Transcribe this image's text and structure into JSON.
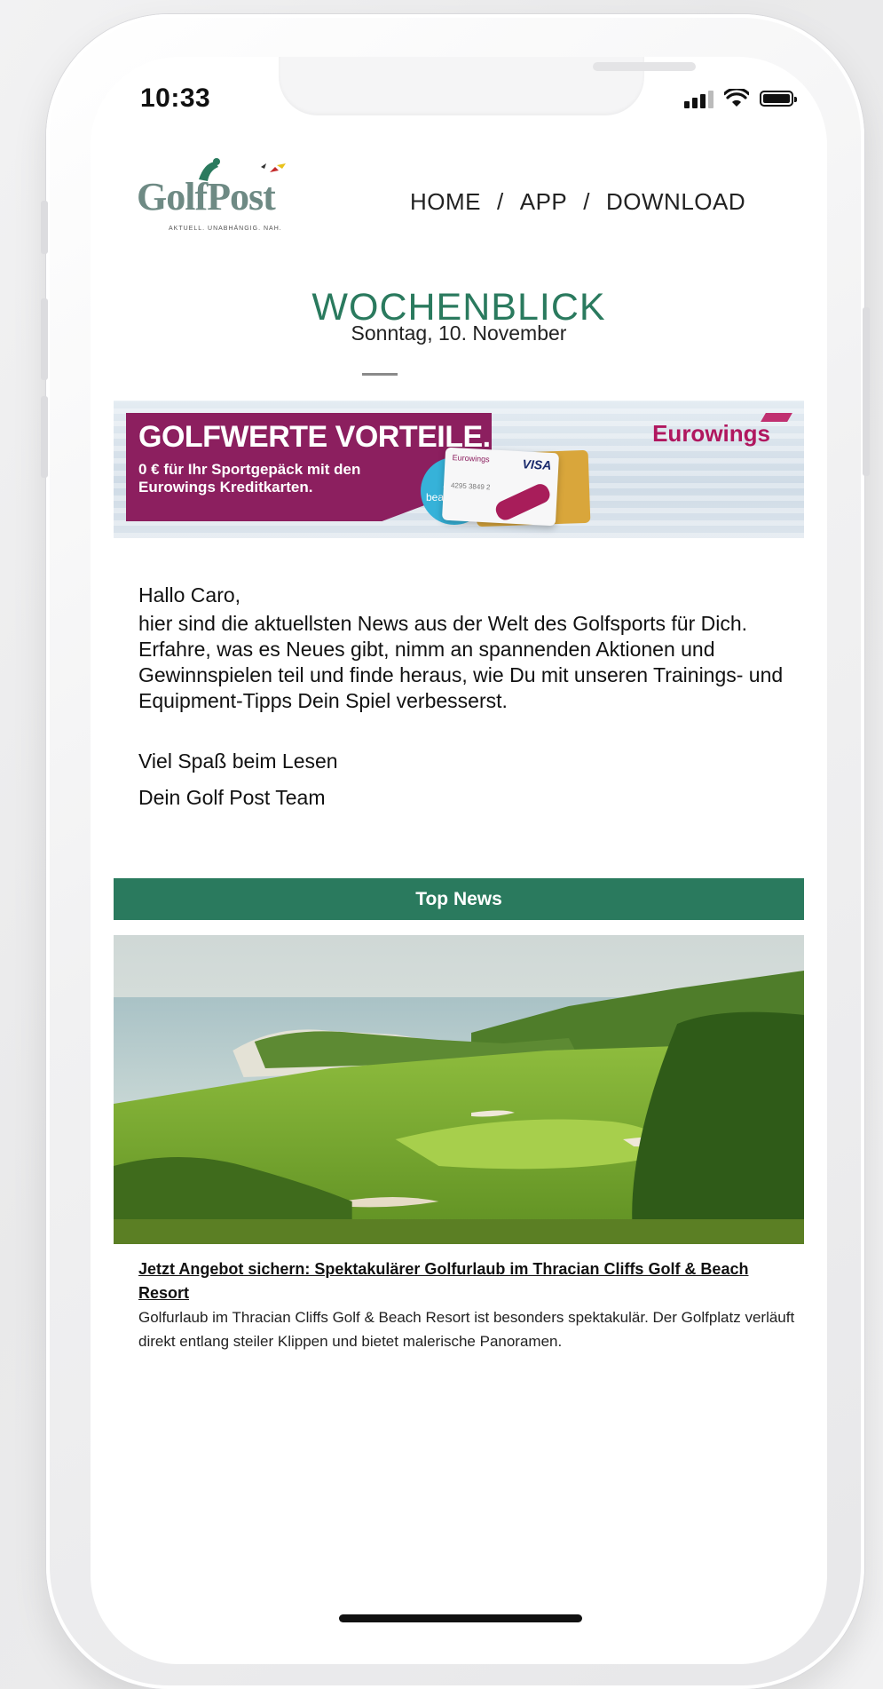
{
  "status_bar": {
    "time": "10:33"
  },
  "brand": {
    "logo_text": "GolfPost",
    "tagline": "AKTUELL. UNABHÄNGIG. NAH."
  },
  "nav": {
    "items": [
      "HOME",
      "APP",
      "DOWNLOAD"
    ],
    "separator": "/"
  },
  "header": {
    "title": "WOCHENBLICK",
    "date": "Sonntag, 10. November"
  },
  "banner": {
    "headline": "GOLFWERTE VORTEILE.",
    "subline": "0 € für Ihr Sportgepäck mit den Eurowings Kreditkarten.",
    "cta": "Jetzt beantragen!",
    "brand": "Eurowings",
    "card_brand": "VISA",
    "card_issuer": "Eurowings",
    "card_number": "4295 3849 2"
  },
  "intro": {
    "greeting": "Hallo Caro,",
    "body": "hier sind die aktuellsten News aus der Welt des Golfsports für Dich. Erfahre, was es Neues gibt, nimm an spannenden Aktionen und Gewinnspielen teil und finde heraus, wie Du mit unseren Trainings- und Equipment-Tipps Dein Spiel verbesserst.",
    "closing": "Viel Spaß beim Lesen",
    "signature": "Dein Golf Post Team"
  },
  "top_news": {
    "section_label": "Top News",
    "article": {
      "title": "Jetzt Angebot sichern: Spektakulärer Golfurlaub im Thracian Cliffs Golf & Beach Resort",
      "description": "Golfurlaub im Thracian Cliffs Golf & Beach Resort ist besonders spektakulär. Der Golfplatz verläuft direkt entlang steiler Klippen und bietet malerische Panoramen."
    }
  },
  "colors": {
    "brand_green": "#2a7a5e",
    "banner_purple": "#8c1f5f",
    "cta_blue": "#36b2d9",
    "eurowings": "#b0175f"
  }
}
